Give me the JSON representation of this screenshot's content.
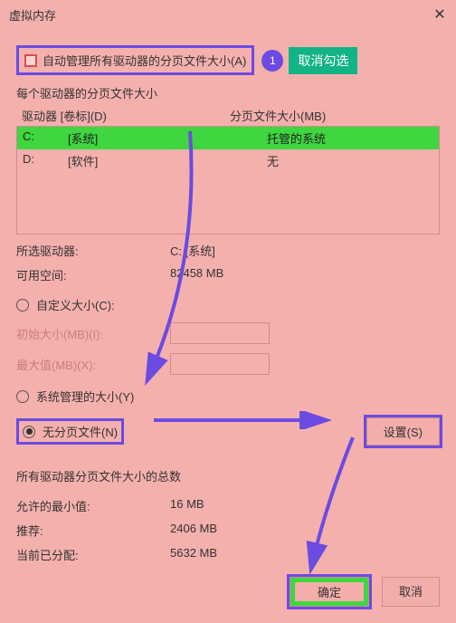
{
  "titlebar": {
    "title": "虚拟内存",
    "close": "✕"
  },
  "auto_manage": {
    "label": "自动管理所有驱动器的分页文件大小(A)"
  },
  "step1": "1",
  "cancel_check_btn": "取消勾选",
  "each_drive_label": "每个驱动器的分页文件大小",
  "list": {
    "head_drive": "驱动器  [卷标](D)",
    "head_size": "分页文件大小(MB)",
    "rows": [
      {
        "drive": "C:",
        "label": "[系统]",
        "size": "托管的系统"
      },
      {
        "drive": "D:",
        "label": "[软件]",
        "size": "无"
      }
    ]
  },
  "selected": {
    "k_drive": "所选驱动器:",
    "v_drive": "C:  [系统]",
    "k_space": "可用空间:",
    "v_space": "82458 MB"
  },
  "radios": {
    "custom": "自定义大小(C):",
    "initial": "初始大小(MB)(I):",
    "max": "最大值(MB)(X):",
    "system": "系统管理的大小(Y)",
    "none": "无分页文件(N)"
  },
  "set_btn": "设置(S)",
  "totals": {
    "title": "所有驱动器分页文件大小的总数",
    "min_k": "允许的最小值:",
    "min_v": "16 MB",
    "rec_k": "推荐:",
    "rec_v": "2406 MB",
    "cur_k": "当前已分配:",
    "cur_v": "5632 MB"
  },
  "ok_btn": "确定",
  "cancel_btn": "取消"
}
